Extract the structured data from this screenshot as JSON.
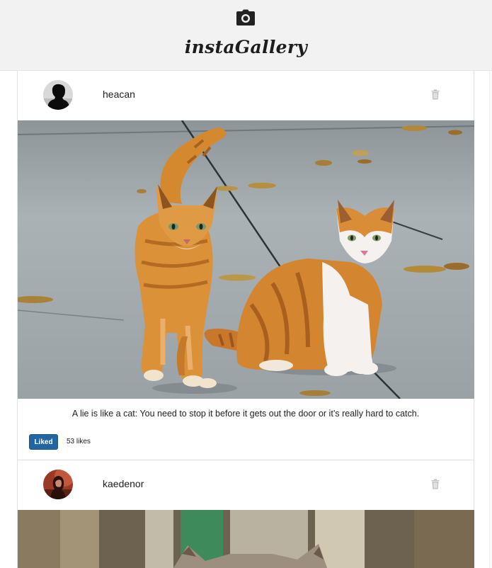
{
  "app": {
    "title": "instaGallery",
    "logo_icon": "camera-icon"
  },
  "colors": {
    "header_bg": "#f2f2f2",
    "liked_button_bg": "#2166a3",
    "liked_button_text": "#ffffff"
  },
  "posts": [
    {
      "username": "heacan",
      "delete_icon": "trash-icon",
      "image_subject": "two orange tabby cats on pavement",
      "caption": "A lie is like a cat: You need to stop it before it gets out the door or it’s really hard to catch.",
      "like_button_label": "Liked",
      "likes_text": "53 likes"
    },
    {
      "username": "kaedenor",
      "delete_icon": "trash-icon",
      "image_subject": "cat among trees"
    }
  ]
}
